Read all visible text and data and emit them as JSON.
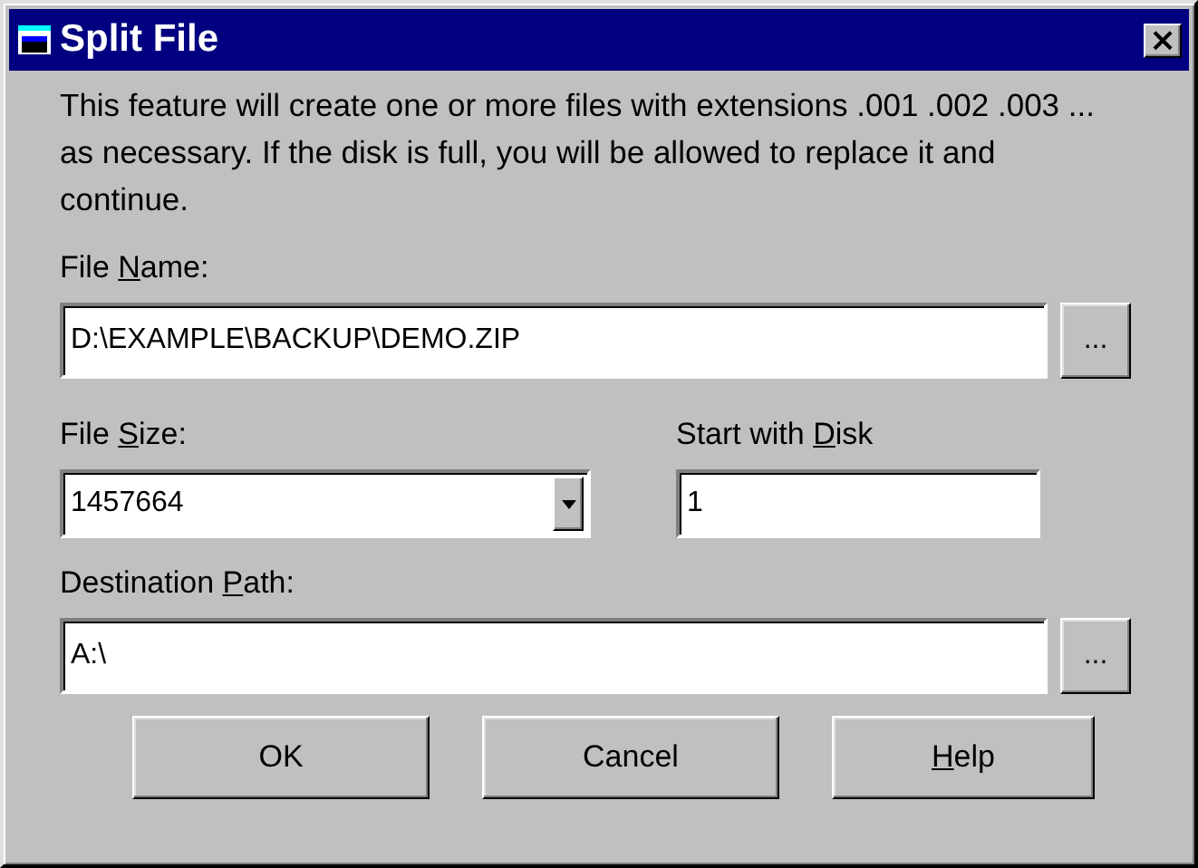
{
  "window": {
    "title": "Split File",
    "close": "×"
  },
  "description": "This feature will create one or more files with extensions .001 .002 .003 ... as necessary.  If the disk is full, you will be allowed to replace it and continue.",
  "file_name": {
    "label": [
      {
        "text": "File "
      },
      {
        "text": "N",
        "underline": true
      },
      {
        "text": "ame:"
      }
    ],
    "value": "D:\\EXAMPLE\\BACKUP\\DEMO.ZIP",
    "browse": "..."
  },
  "file_size": {
    "label": [
      {
        "text": "File "
      },
      {
        "text": "S",
        "underline": true
      },
      {
        "text": "ize:"
      }
    ],
    "value": "1457664"
  },
  "start_disk": {
    "label": [
      {
        "text": "Start with "
      },
      {
        "text": "D",
        "underline": true
      },
      {
        "text": "isk"
      }
    ],
    "value": "1"
  },
  "destination": {
    "label": [
      {
        "text": "Destination "
      },
      {
        "text": "P",
        "underline": true
      },
      {
        "text": "ath:"
      }
    ],
    "value": "A:\\",
    "browse": "..."
  },
  "buttons": [
    {
      "label": [
        {
          "text": "OK"
        }
      ]
    },
    {
      "label": [
        {
          "text": "Cancel"
        }
      ]
    },
    {
      "label": [
        {
          "text": "H",
          "underline": true
        },
        {
          "text": "elp"
        }
      ]
    }
  ]
}
